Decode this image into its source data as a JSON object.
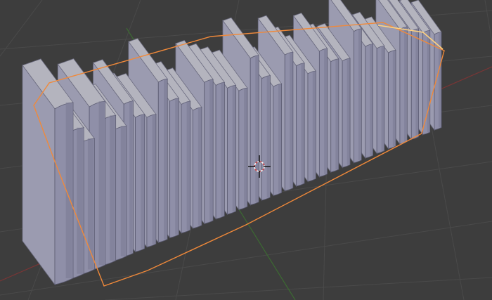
{
  "viewport": {
    "mode": "3D View",
    "background_color": "#3d3d3d",
    "grid_color": "#4a4a4a",
    "x_axis_color": "#b03c3c",
    "y_axis_color": "#4a8a3a",
    "selection_outline_color": "#f0893a",
    "active_outline_color": "#ffd27f",
    "object_base_color": "#8f8fa8"
  },
  "object": {
    "name_icon": "books-mesh-icon",
    "selected": true
  },
  "cursor": {
    "icon": "3d-cursor-icon"
  }
}
